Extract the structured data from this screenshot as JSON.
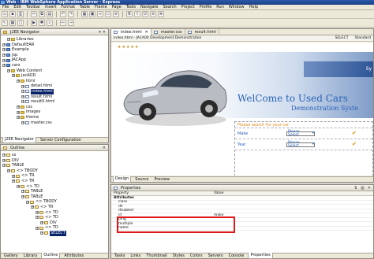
{
  "window": {
    "title": "Web - IBM WebSphere Application Server - Express"
  },
  "menu": [
    "File",
    "Edit",
    "Toolbar",
    "Insert",
    "Format",
    "Table",
    "Frame",
    "Page",
    "Tools",
    "Navigate",
    "Search",
    "Project",
    "Profile",
    "Run",
    "Window",
    "Help"
  ],
  "navigator": {
    "title": "J2EE Navigator",
    "items": [
      {
        "label": "Libraries",
        "depth": 1,
        "icon": "folder"
      },
      {
        "label": "DefaultEAR",
        "depth": 0,
        "icon": "prj"
      },
      {
        "label": "Example",
        "depth": 0,
        "icon": "prj"
      },
      {
        "label": "jsp",
        "depth": 0,
        "icon": "prj"
      },
      {
        "label": "JACApp",
        "depth": 0,
        "icon": "prj"
      },
      {
        "label": "cars",
        "depth": 0,
        "icon": "prj"
      },
      {
        "label": "Web Content",
        "depth": 1,
        "icon": "folder"
      },
      {
        "label": "jacAOD",
        "depth": 2,
        "icon": "folder"
      },
      {
        "label": "html",
        "depth": 3,
        "icon": "folder"
      },
      {
        "label": "detail.html",
        "depth": 4,
        "icon": "file"
      },
      {
        "label": "index.html",
        "depth": 4,
        "icon": "file",
        "selected": true
      },
      {
        "label": "result.html",
        "depth": 4,
        "icon": "file"
      },
      {
        "label": "result0.html",
        "depth": 4,
        "icon": "file"
      },
      {
        "label": "css",
        "depth": 3,
        "icon": "folder"
      },
      {
        "label": "images",
        "depth": 3,
        "icon": "folder"
      },
      {
        "label": "theme",
        "depth": 3,
        "icon": "folder"
      },
      {
        "label": "master.css",
        "depth": 4,
        "icon": "file"
      }
    ],
    "tabs": [
      "J2EE Navigator",
      "Server Configuration"
    ]
  },
  "outline": {
    "title": "Outline",
    "items": [
      {
        "label": "ss",
        "depth": 0
      },
      {
        "label": "DIV",
        "depth": 0
      },
      {
        "label": "TABLE",
        "depth": 0
      },
      {
        "label": "<> TBODY",
        "depth": 1
      },
      {
        "label": "<> TR",
        "depth": 2
      },
      {
        "label": "<> TR",
        "depth": 2
      },
      {
        "label": "<> TD",
        "depth": 3
      },
      {
        "label": "TABLE",
        "depth": 4
      },
      {
        "label": "TABLE",
        "depth": 4
      },
      {
        "label": "<> TBODY",
        "depth": 5
      },
      {
        "label": "<> TR",
        "depth": 6
      },
      {
        "label": "<> TD",
        "depth": 7
      },
      {
        "label": "<> TD",
        "depth": 7
      },
      {
        "label": "DIV",
        "depth": 8
      },
      {
        "label": "<> TD",
        "depth": 7
      },
      {
        "label": "SELECT",
        "depth": 8,
        "selected": true
      }
    ],
    "tabs": [
      "Gallery",
      "Library",
      "Outline",
      "Attributes"
    ]
  },
  "editor": {
    "tabs": [
      {
        "label": "index.html",
        "active": true
      },
      {
        "label": "master.css",
        "active": false
      },
      {
        "label": "result.html",
        "active": false
      }
    ],
    "path": "index.html - JACA00 Development Demonstration",
    "select_label": "SELECT",
    "style_label": "Standard",
    "stars": "★★★★★",
    "sys_text": "Sy",
    "welcome": "WelCome to Used Cars",
    "subtitle": "Demonstration Syste",
    "search_text": "Please search for your car",
    "make_label": "Make",
    "year_label": "Year",
    "select_placeholder": "Please Select",
    "modes": [
      "Design",
      "Source",
      "Preview"
    ]
  },
  "properties": {
    "title": "Properties",
    "col_property": "Property",
    "col_value": "Value",
    "rows": [
      {
        "name": "Attributes",
        "value": "",
        "group": true
      },
      {
        "name": "class",
        "value": ""
      },
      {
        "name": "dir",
        "value": ""
      },
      {
        "name": "disabled",
        "value": ""
      },
      {
        "name": "id",
        "value": "make"
      },
      {
        "name": "lang",
        "value": ""
      },
      {
        "name": "multiple",
        "value": ""
      },
      {
        "name": "name",
        "value": ""
      }
    ],
    "tabs": [
      "Tasks",
      "Links",
      "Thumbnail",
      "Styles",
      "Colors",
      "Servers",
      "Console",
      "Properties"
    ]
  },
  "colors": {
    "accent": "#2a62b8",
    "highlight": "#e01818",
    "selection": "#0a246a"
  }
}
